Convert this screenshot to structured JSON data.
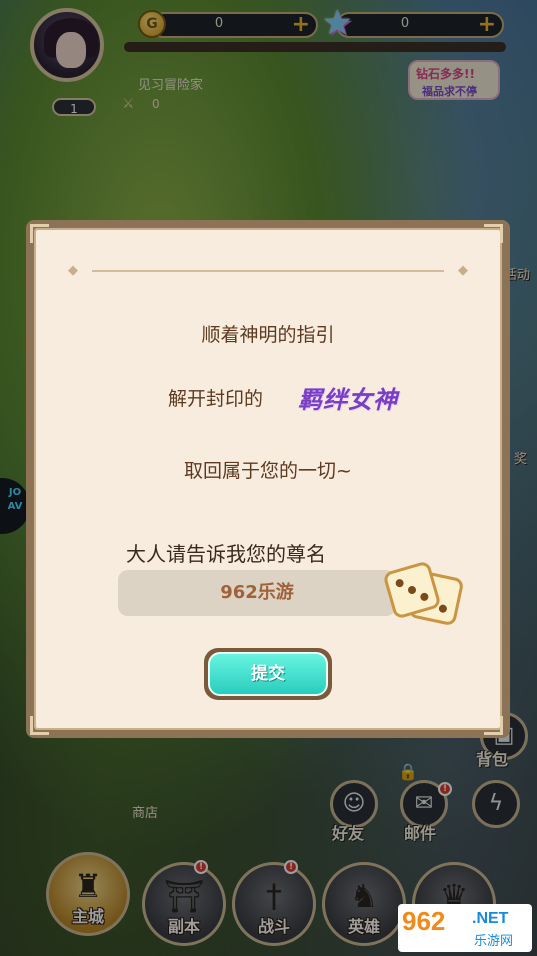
{
  "player": {
    "title": "见习冒险家",
    "level": "1",
    "power": "0"
  },
  "resources": {
    "gold": {
      "icon": "gold-coin-icon",
      "symbol": "G",
      "value": "0"
    },
    "gems": {
      "icon": "rainbow-star-icon",
      "value": "0"
    }
  },
  "promo": {
    "line1": "钻石多多!!",
    "line2": "福品求不停"
  },
  "side": {
    "right_top": "活动",
    "right_mid": "奖",
    "left_logo": "JO AV"
  },
  "dialog": {
    "line1": "顺着神明的指引",
    "line2_prefix": "解开封印的",
    "line2_name": "羁绊女神",
    "line3": "取回属于您的一切~",
    "prompt": "大人请告诉我您的尊名",
    "name_value": "962乐游",
    "random_icon": "dice-icon",
    "submit_label": "提交"
  },
  "lower": {
    "shop": "商店",
    "bag": "背包",
    "friends": "好友",
    "mail": "邮件",
    "mail_badge": "!"
  },
  "nav": [
    {
      "label": "主城",
      "icon": "castle-icon"
    },
    {
      "label": "副本",
      "icon": "temple-icon",
      "badge": "!"
    },
    {
      "label": "战斗",
      "icon": "sword-icon",
      "badge": "!"
    },
    {
      "label": "英雄",
      "icon": "hero-icon"
    },
    {
      "label": "",
      "icon": "crown-icon"
    }
  ],
  "watermark": {
    "number": "962",
    "domain": ".NET",
    "name": "乐游网"
  },
  "colors": {
    "dialog_bg": "#f7ecdd",
    "dialog_text": "#5c3b22",
    "goddess_name": "#7a3ec4",
    "submit_button": "#3fdccb",
    "gold": "#f0b52a"
  }
}
